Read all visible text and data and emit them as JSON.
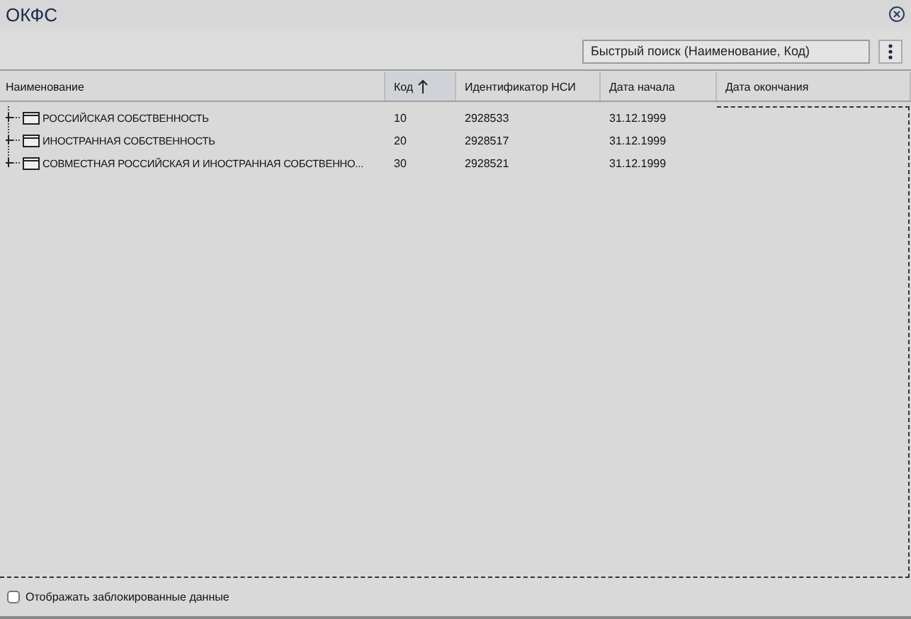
{
  "window": {
    "title": "ОКФС"
  },
  "search": {
    "placeholder": "Быстрый поиск (Наименование, Код)"
  },
  "table": {
    "columns": [
      {
        "label": "Наименование",
        "sorted": false
      },
      {
        "label": "Код",
        "sorted": true
      },
      {
        "label": "Идентификатор НСИ",
        "sorted": false
      },
      {
        "label": "Дата начала",
        "sorted": false
      },
      {
        "label": "Дата окончания",
        "sorted": false
      }
    ],
    "rows": [
      {
        "expanded": false,
        "cells": [
          "РОССИЙСКАЯ СОБСТВЕННОСТЬ",
          "10",
          "2928533",
          "31.12.1999"
        ]
      },
      {
        "expanded": false,
        "cells": [
          "ИНОСТРАННАЯ СОБСТВЕННОСТЬ",
          "20",
          "2928517",
          "31.12.1999"
        ]
      },
      {
        "expanded": false,
        "cells": [
          "СОВМЕСТНАЯ РОССИЙСКАЯ И ИНОСТРАННАЯ СОБСТВЕННО...",
          "30",
          "2928521",
          "31.12.1999"
        ]
      }
    ]
  },
  "footer": {
    "checkbox": {
      "label": "Отображать заблокированные данные",
      "checked": false
    }
  }
}
